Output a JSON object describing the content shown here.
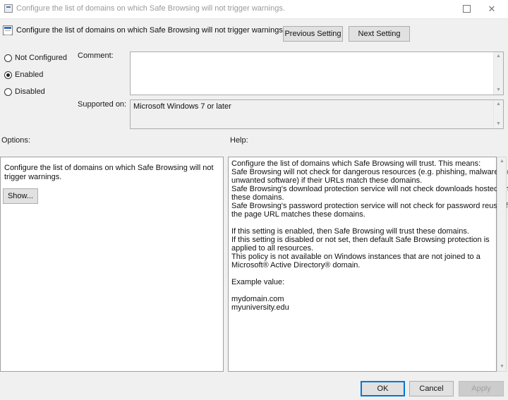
{
  "window": {
    "title": "Configure the list of domains on which Safe Browsing will not trigger warnings.",
    "maximize_icon": "maximize-icon",
    "close_icon": "close-icon",
    "close_glyph": "✕"
  },
  "header": {
    "policy_title": "Configure the list of domains on which Safe Browsing will not trigger warnings.",
    "previous_label": "Previous Setting",
    "next_label": "Next Setting"
  },
  "state": {
    "options": [
      {
        "label": "Not Configured",
        "checked": false
      },
      {
        "label": "Enabled",
        "checked": true
      },
      {
        "label": "Disabled",
        "checked": false
      }
    ]
  },
  "comment": {
    "label": "Comment:",
    "value": ""
  },
  "supported": {
    "label": "Supported on:",
    "value": "Microsoft Windows 7 or later"
  },
  "options_panel": {
    "heading": "Options:",
    "text": "Configure the list of domains on which Safe Browsing will not trigger warnings.",
    "show_label": "Show..."
  },
  "help_panel": {
    "heading": "Help:",
    "lines": [
      "Configure the list of domains which Safe Browsing will trust. This means:",
      "Safe Browsing will not check for dangerous resources (e.g. phishing, malware, or",
      "unwanted software) if their URLs match these domains.",
      "Safe Browsing's download protection service will not check downloads hosted on",
      "these domains.",
      "Safe Browsing's password protection service will not check for password reuse if",
      "the page URL matches these domains.",
      "",
      "If this setting is enabled, then Safe Browsing will trust these domains.",
      "If this setting is disabled or not set, then default Safe Browsing protection is",
      "applied to all resources.",
      "This policy is not available on Windows instances that are not joined to a",
      "Microsoft® Active Directory® domain.",
      "",
      "Example value:",
      "",
      "mydomain.com",
      "myuniversity.edu"
    ]
  },
  "footer": {
    "ok_label": "OK",
    "cancel_label": "Cancel",
    "apply_label": "Apply"
  },
  "colors": {
    "dialog_bg": "#f0f0f0",
    "default_button_border": "#0078d7"
  }
}
